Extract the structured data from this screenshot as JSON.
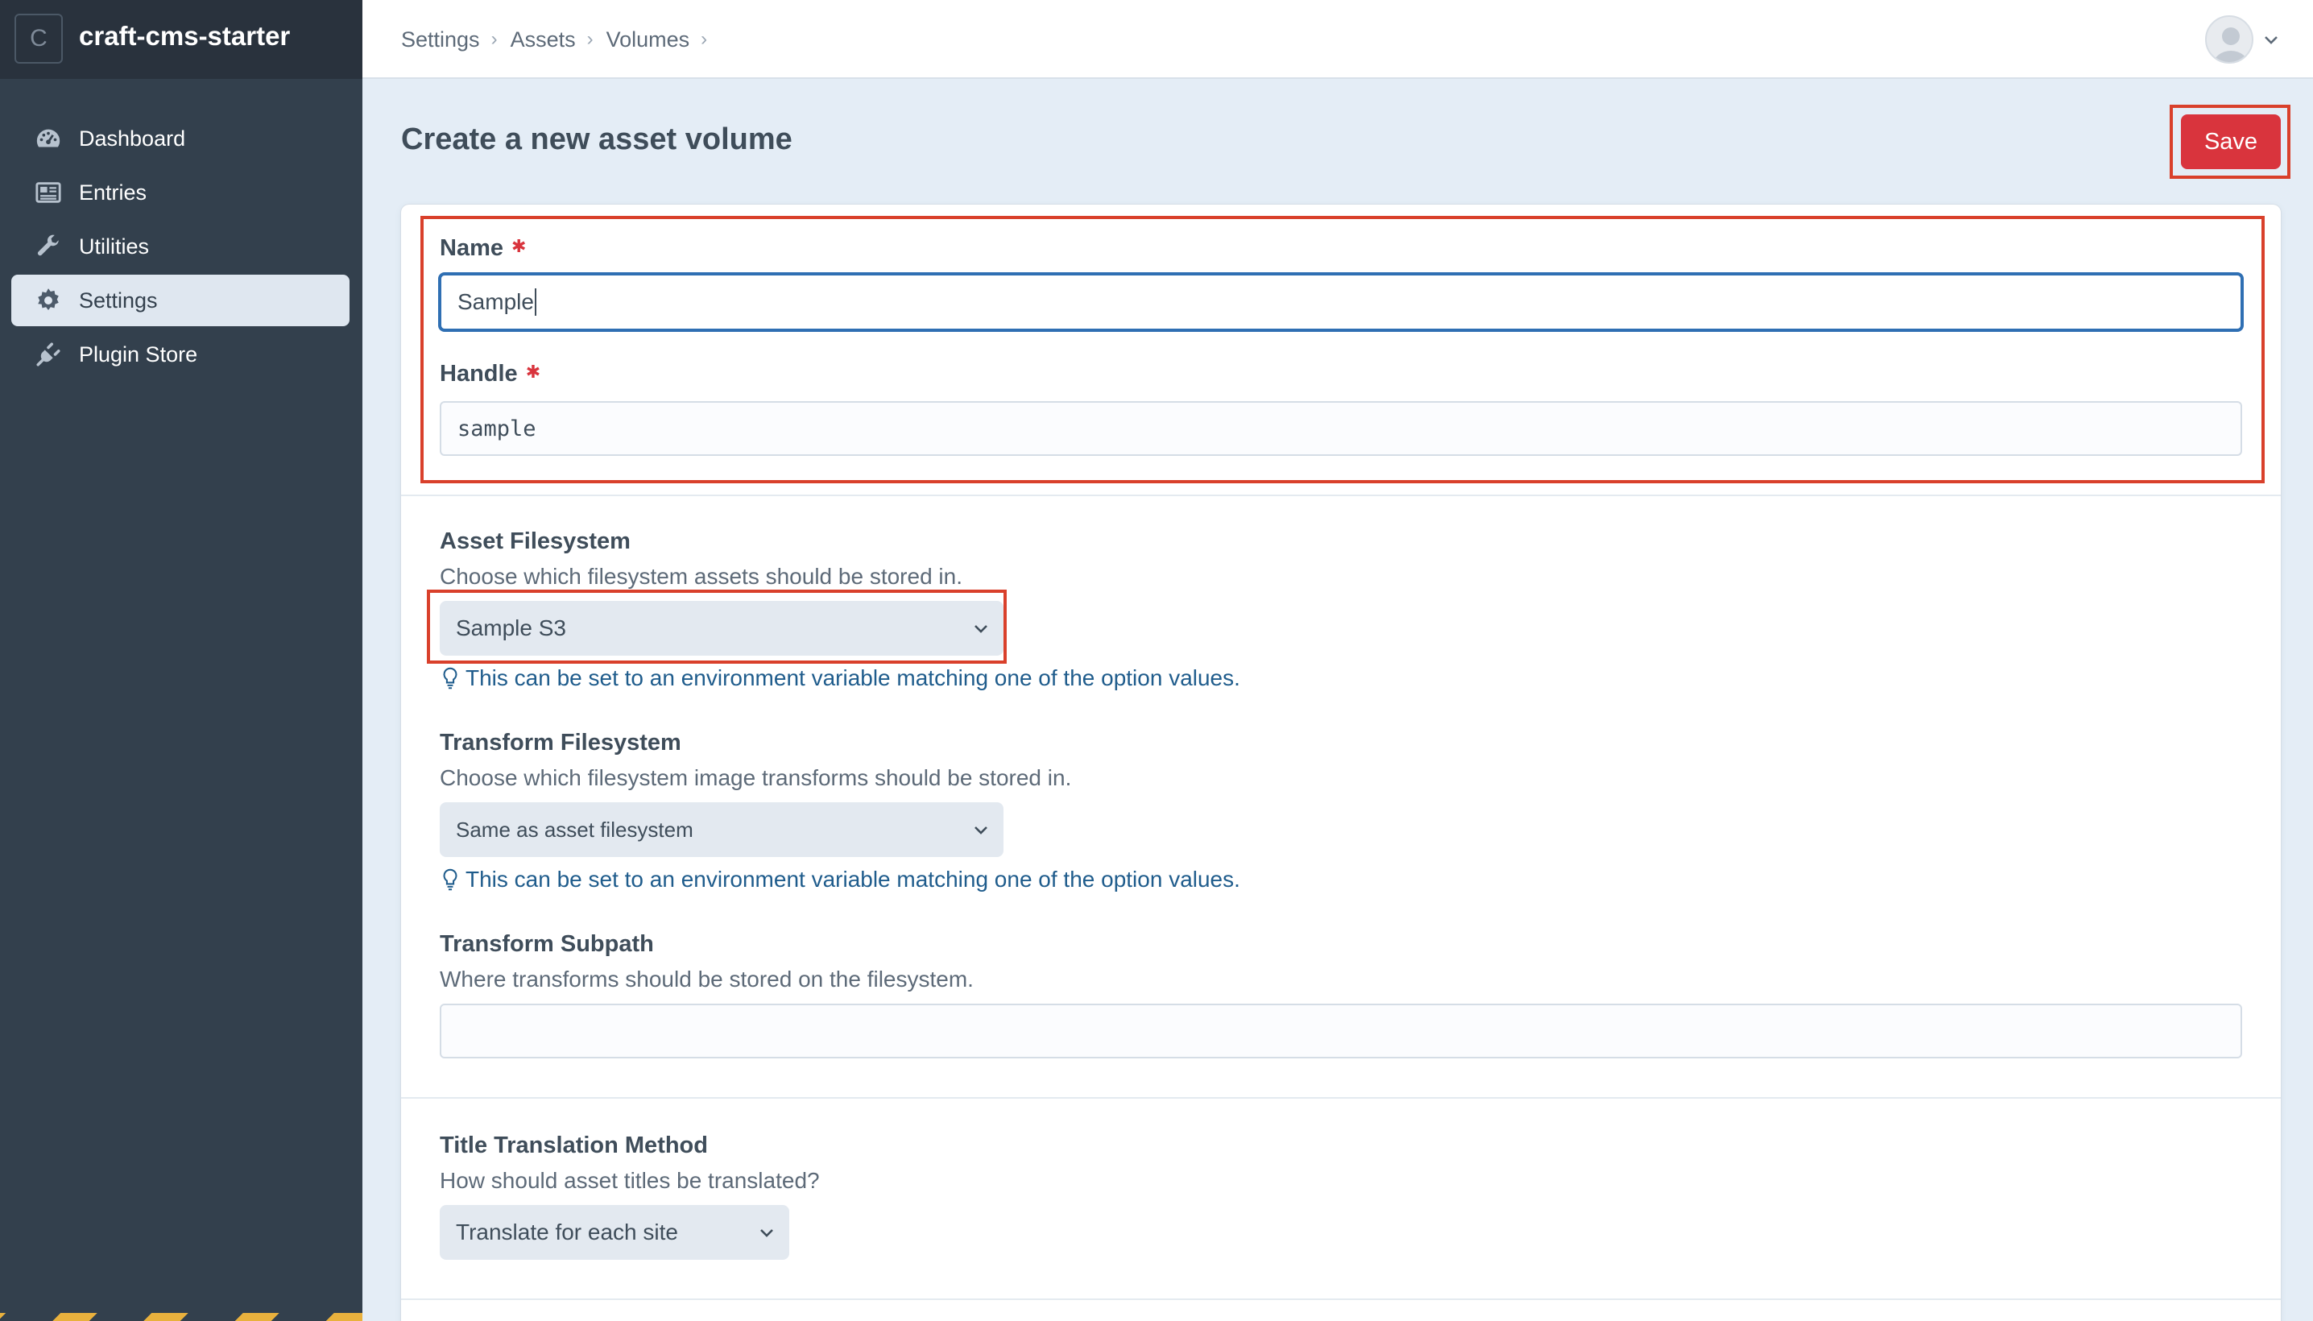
{
  "site": {
    "icon_letter": "C",
    "name": "craft-cms-starter"
  },
  "nav": [
    {
      "label": "Dashboard",
      "icon": "gauge-icon"
    },
    {
      "label": "Entries",
      "icon": "newspaper-icon"
    },
    {
      "label": "Utilities",
      "icon": "wrench-icon"
    },
    {
      "label": "Settings",
      "icon": "gear-icon",
      "active": true
    },
    {
      "label": "Plugin Store",
      "icon": "plug-icon"
    }
  ],
  "breadcrumb": [
    "Settings",
    "Assets",
    "Volumes"
  ],
  "page": {
    "title": "Create a new asset volume",
    "save_label": "Save"
  },
  "form": {
    "name": {
      "label": "Name",
      "value": "Sample"
    },
    "handle": {
      "label": "Handle",
      "value": "sample"
    },
    "asset_fs": {
      "label": "Asset Filesystem",
      "instructions": "Choose which filesystem assets should be stored in.",
      "selected": "Sample S3",
      "tip": "This can be set to an environment variable matching one of the option values."
    },
    "transform_fs": {
      "label": "Transform Filesystem",
      "instructions": "Choose which filesystem image transforms should be stored in.",
      "selected": "Same as asset filesystem",
      "tip": "This can be set to an environment variable matching one of the option values."
    },
    "transform_subpath": {
      "label": "Transform Subpath",
      "instructions": "Where transforms should be stored on the filesystem.",
      "value": ""
    },
    "title_translation": {
      "label": "Title Translation Method",
      "instructions": "How should asset titles be translated?",
      "selected": "Translate for each site"
    }
  },
  "colors": {
    "accent_red": "#d9343d",
    "focus_blue": "#2f6fb3",
    "sidebar_bg": "#33404d",
    "highlight": "#d9402b"
  }
}
